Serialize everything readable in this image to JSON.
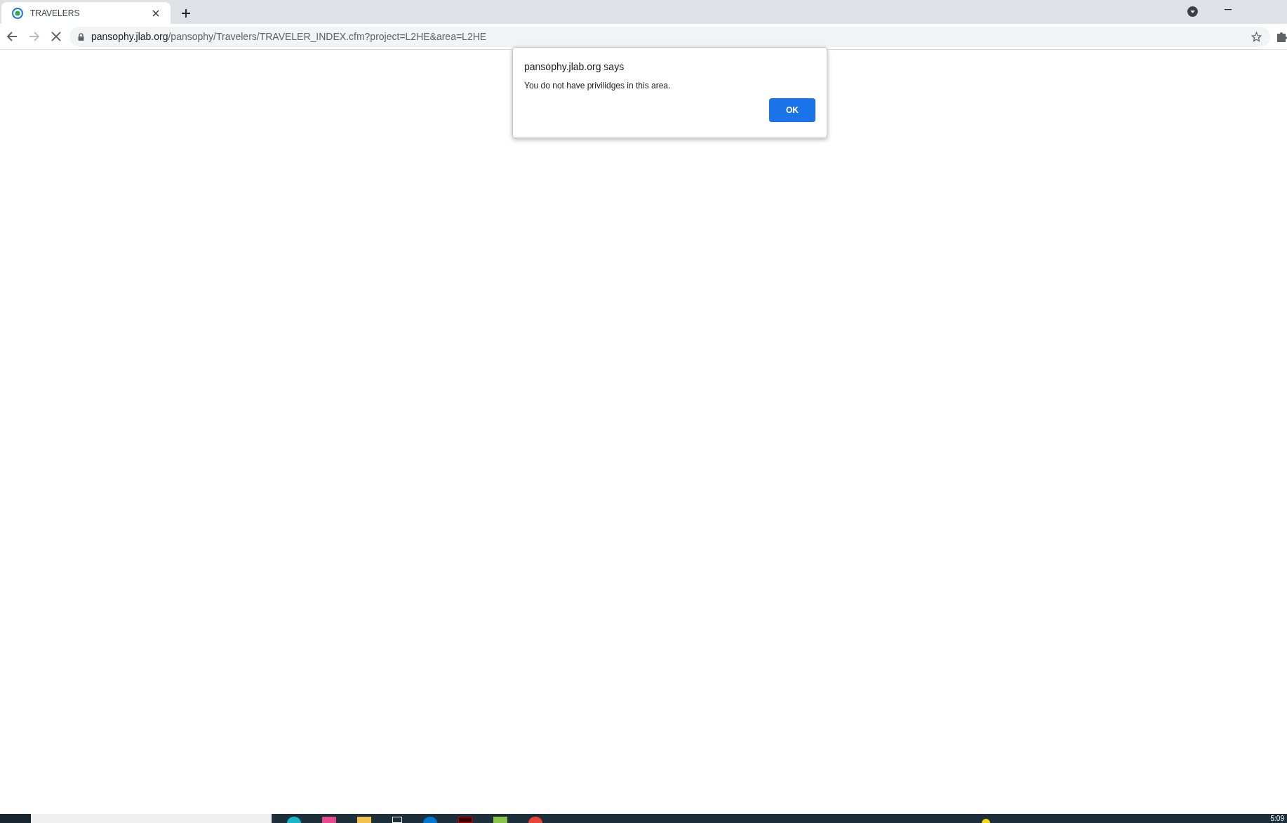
{
  "browser": {
    "tab": {
      "title": "TRAVELERS"
    },
    "url": {
      "host": "pansophy.jlab.org",
      "path": "/pansophy/Travelers/TRAVELER_INDEX.cfm?project=L2HE&area=L2HE"
    },
    "loading": true
  },
  "dialog": {
    "title": "pansophy.jlab.org says",
    "message": "You do not have privilidges in this area.",
    "button": "OK"
  },
  "taskbar": {
    "clock": "5:09"
  }
}
